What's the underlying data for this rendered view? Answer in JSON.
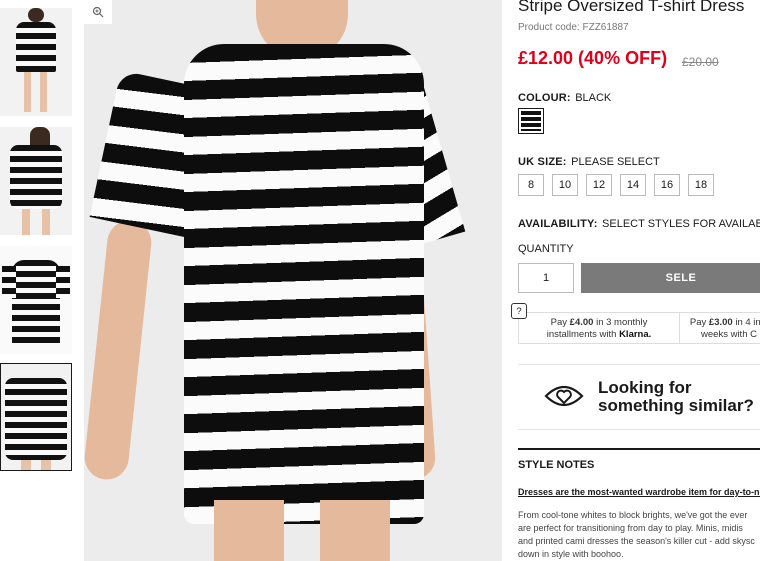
{
  "product": {
    "title": "Stripe Oversized T-shirt Dress",
    "code": "Product code: FZZ61887",
    "price": "£12.00 (40% OFF)",
    "old_price": "£20.00"
  },
  "colour": {
    "label": "COLOUR:",
    "value": "BLACK"
  },
  "size": {
    "label": "UK SIZE:",
    "value": "PLEASE SELECT",
    "options": [
      "8",
      "10",
      "12",
      "14",
      "16",
      "18"
    ]
  },
  "availability": {
    "label": "AVAILABILITY:",
    "value": "SELECT STYLES FOR AVAILABILI"
  },
  "quantity": {
    "label": "QUANTITY",
    "value": "1"
  },
  "add_button": "SELE",
  "help_icon": "?",
  "payments": [
    {
      "line1_pre": "Pay ",
      "amount": "£4.00",
      "line1_post": " in 3 monthly",
      "line2": "installments with ",
      "brand": "Klarna."
    },
    {
      "line1_pre": "Pay ",
      "amount": "£3.00",
      "line1_post": " in 4 inst",
      "line2": "weeks with C",
      "brand": ""
    }
  ],
  "similar": {
    "line1": "Looking for",
    "line2": "something similar?"
  },
  "style_notes": {
    "heading": "STYLE NOTES",
    "link": "Dresses are the most-wanted wardrobe item for day-to-ni",
    "lines": [
      "From cool-tone whites to block brights, we've got the ever",
      "are perfect for transitioning from day to play. Minis, midis",
      "and printed cami dresses the season's killer cut - add skysc",
      "down in style with boohoo."
    ]
  },
  "icons": {
    "zoom": "zoom-in-icon",
    "eye": "eye-heart-icon",
    "help": "question-icon"
  }
}
